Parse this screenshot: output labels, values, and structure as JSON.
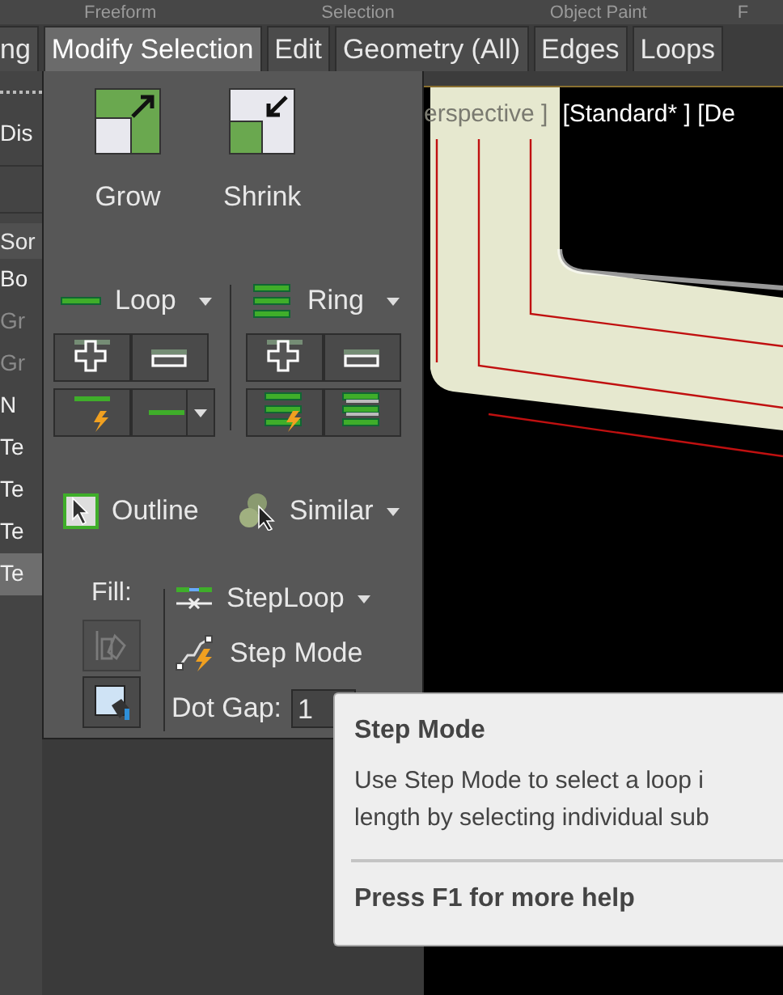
{
  "top_tabs": [
    {
      "label": "Freeform"
    },
    {
      "label": "Selection"
    },
    {
      "label": "Object Paint"
    },
    {
      "label": "F"
    }
  ],
  "ribbon_tabs": [
    {
      "label": "ng",
      "selected": false
    },
    {
      "label": "Modify Selection",
      "selected": true
    },
    {
      "label": "Edit",
      "selected": false
    },
    {
      "label": "Geometry (All)",
      "selected": false
    },
    {
      "label": "Edges",
      "selected": false
    },
    {
      "label": "Loops",
      "selected": false
    }
  ],
  "side_list": {
    "header": "Dis",
    "sort_label": "Sor",
    "items": [
      {
        "label": "Bo",
        "disabled": false,
        "selected": false
      },
      {
        "label": "Gr",
        "disabled": true,
        "selected": false
      },
      {
        "label": "Gr",
        "disabled": true,
        "selected": false
      },
      {
        "label": "N",
        "disabled": false,
        "selected": false
      },
      {
        "label": "Te",
        "disabled": false,
        "selected": false
      },
      {
        "label": "Te",
        "disabled": false,
        "selected": false
      },
      {
        "label": "Te",
        "disabled": false,
        "selected": false
      },
      {
        "label": "Te",
        "disabled": false,
        "selected": true
      }
    ]
  },
  "viewport": {
    "labels": [
      "erspective ]",
      "[Standard* ] [De"
    ]
  },
  "panel": {
    "big_buttons": [
      {
        "label": "Grow",
        "kind": "grow"
      },
      {
        "label": "Shrink",
        "kind": "shrink"
      }
    ],
    "loop": {
      "label": "Loop"
    },
    "ring": {
      "label": "Ring"
    },
    "outline": {
      "label": "Outline"
    },
    "similar": {
      "label": "Similar"
    },
    "fill": {
      "label": "Fill:",
      "buttons": [
        {
          "disabled": true
        },
        {
          "disabled": false
        }
      ]
    },
    "steploop": {
      "label": "StepLoop"
    },
    "step_mode": {
      "label": "Step Mode"
    },
    "dot_gap": {
      "label": "Dot Gap:",
      "value": "1"
    }
  },
  "tooltip": {
    "title": "Step Mode",
    "lines": [
      "Use Step Mode to select a loop i",
      "length by selecting individual sub"
    ],
    "footer": "Press F1 for more help"
  }
}
